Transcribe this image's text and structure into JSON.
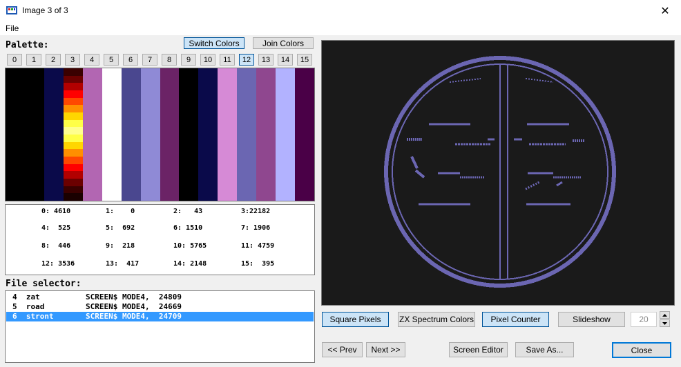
{
  "window": {
    "title": "Image 3 of 3",
    "close_glyph": "✕",
    "icon": "app-icon"
  },
  "menu": {
    "file": "File"
  },
  "palette": {
    "label": "Palette:",
    "switch_colors": "Switch Colors",
    "join_colors": "Join Colors",
    "indices": [
      "0",
      "1",
      "2",
      "3",
      "4",
      "5",
      "6",
      "7",
      "8",
      "9",
      "10",
      "11",
      "12",
      "13",
      "14",
      "15"
    ],
    "selected_index": 12,
    "colors": [
      "#000000",
      "#000000",
      "#0a0a4a",
      "gradient",
      "#b266b2",
      "#ffffff",
      "#4a478f",
      "#8f8ad6",
      "#6b2366",
      "#000000",
      "#0a0a4a",
      "#d68ad6",
      "#6b66b2",
      "#8f478f",
      "#b2b2ff",
      "#4a0047"
    ],
    "gradient_colors": [
      "#3a0000",
      "#6b0000",
      "#b20000",
      "#ff0000",
      "#ff4700",
      "#ff8f00",
      "#ffd600",
      "#ffff47",
      "#ffff8f",
      "#ffff47",
      "#ffd600",
      "#ff8f00",
      "#ff4700",
      "#ff0000",
      "#b20000",
      "#6b0000",
      "#3a0000",
      "#1a0000"
    ]
  },
  "pixel_counts": [
    "0: 4610",
    "1:    0",
    "2:   43",
    "3:22182",
    "4:  525",
    "5:  692",
    "6: 1510",
    "7: 1906",
    "8:  446",
    "9:  218",
    "10: 5765",
    "11: 4759",
    "12: 3536",
    "13:  417",
    "14: 2148",
    "15:  395"
  ],
  "file_selector": {
    "label": "File selector:",
    "rows": [
      {
        "text": "4  zat          SCREEN$ MODE4,  24809",
        "selected": false
      },
      {
        "text": "5  road         SCREEN$ MODE4,  24669",
        "selected": false
      },
      {
        "text": "6  stront       SCREEN$ MODE4,  24709",
        "selected": true
      }
    ]
  },
  "screen": {
    "fg_color": "#6b66b2",
    "bg_color": "#1a1a1a"
  },
  "controls": {
    "square_pixels": "Square Pixels",
    "zx_colors": "ZX Spectrum Colors",
    "pixel_counter": "Pixel Counter",
    "slideshow": "Slideshow",
    "slideshow_seconds": "20",
    "prev": "<< Prev",
    "next": "Next >>",
    "screen_editor": "Screen Editor",
    "save_as": "Save As...",
    "close": "Close"
  }
}
